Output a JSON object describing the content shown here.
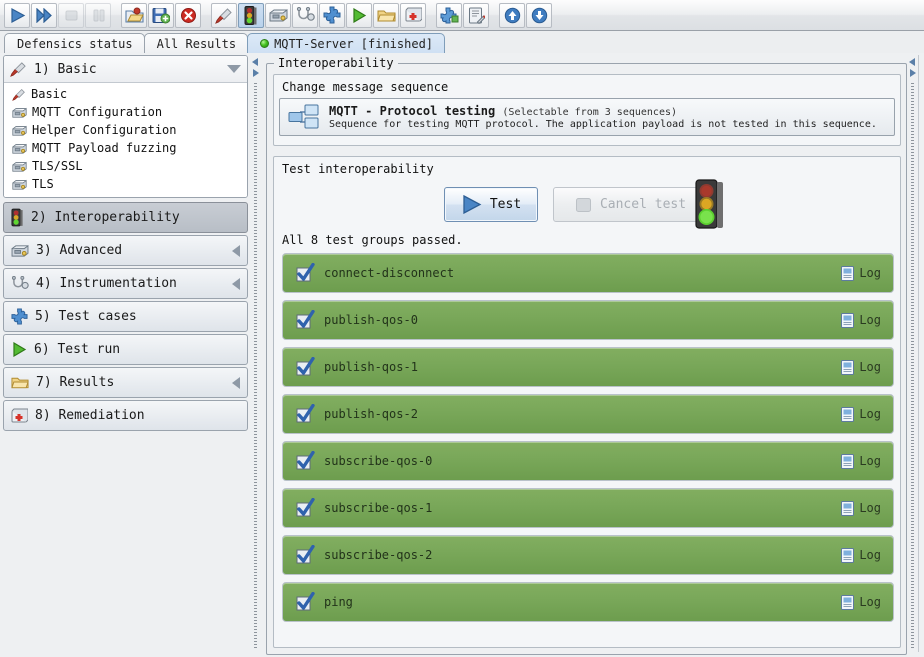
{
  "toolbar": {
    "buttons": [
      {
        "name": "run-icon",
        "label": "Run",
        "state": "enabled"
      },
      {
        "name": "step-icon",
        "label": "Step",
        "state": "enabled"
      },
      {
        "name": "stop-icon",
        "label": "Stop",
        "state": "disabled"
      },
      {
        "name": "pause-icon",
        "label": "Pause",
        "state": "disabled"
      },
      {
        "name": "open-folder-icon",
        "label": "Open",
        "state": "enabled"
      },
      {
        "name": "save-icon",
        "label": "Save",
        "state": "enabled"
      },
      {
        "name": "close-icon",
        "label": "Close",
        "state": "enabled"
      },
      {
        "name": "screwdriver-icon",
        "label": "Basic",
        "state": "enabled"
      },
      {
        "name": "traffic-light-icon",
        "label": "Interoperability",
        "state": "active"
      },
      {
        "name": "toolbox-icon",
        "label": "Advanced",
        "state": "enabled"
      },
      {
        "name": "stethoscope-icon",
        "label": "Instrumentation",
        "state": "enabled"
      },
      {
        "name": "puzzle-icon",
        "label": "Test cases",
        "state": "enabled"
      },
      {
        "name": "play-green-icon",
        "label": "Test run",
        "state": "enabled"
      },
      {
        "name": "folder-icon",
        "label": "Results",
        "state": "enabled"
      },
      {
        "name": "first-aid-icon",
        "label": "Remediation",
        "state": "enabled"
      },
      {
        "name": "plugin-icon",
        "label": "Plugins",
        "state": "enabled"
      },
      {
        "name": "notes-icon",
        "label": "Notes",
        "state": "enabled"
      },
      {
        "name": "arrow-up-icon",
        "label": "Previous",
        "state": "enabled"
      },
      {
        "name": "arrow-down-icon",
        "label": "Next",
        "state": "enabled"
      }
    ]
  },
  "tabs": [
    {
      "label": "Defensics status",
      "selected": false,
      "has_dot": false
    },
    {
      "label": "All Results",
      "selected": false,
      "has_dot": false
    },
    {
      "label": "MQTT-Server [finished]",
      "selected": true,
      "has_dot": true
    }
  ],
  "sidebar": {
    "open_section": {
      "number_label": "1) Basic",
      "icon": "screwdriver-icon",
      "items": [
        {
          "label": "Basic",
          "icon": "screwdriver-icon"
        },
        {
          "label": "MQTT Configuration",
          "icon": "toolbox-icon"
        },
        {
          "label": "Helper Configuration",
          "icon": "toolbox-icon"
        },
        {
          "label": "MQTT Payload fuzzing",
          "icon": "toolbox-icon"
        },
        {
          "label": "TLS/SSL",
          "icon": "toolbox-icon"
        },
        {
          "label": "TLS",
          "icon": "toolbox-icon"
        }
      ]
    },
    "sections": [
      {
        "label": "2) Interoperability",
        "icon": "traffic-light-icon",
        "selected": true,
        "collapsible": false
      },
      {
        "label": "3) Advanced",
        "icon": "toolbox-icon",
        "selected": false,
        "collapsible": true
      },
      {
        "label": "4) Instrumentation",
        "icon": "stethoscope-icon",
        "selected": false,
        "collapsible": true
      },
      {
        "label": "5) Test cases",
        "icon": "puzzle-icon",
        "selected": false,
        "collapsible": false
      },
      {
        "label": "6) Test run",
        "icon": "play-green-icon",
        "selected": false,
        "collapsible": false
      },
      {
        "label": "7) Results",
        "icon": "folder-icon",
        "selected": false,
        "collapsible": true
      },
      {
        "label": "8) Remediation",
        "icon": "first-aid-icon",
        "selected": false,
        "collapsible": false
      }
    ]
  },
  "main": {
    "group_title": "Interoperability",
    "sequence_group": {
      "label": "Change message sequence",
      "item": {
        "icon": "sequence-boxes-icon",
        "title": "MQTT - Protocol testing",
        "subtitle": "(Selectable from 3 sequences)",
        "description": "Sequence for testing MQTT protocol. The application payload is not tested in this sequence."
      }
    },
    "test_group": {
      "label": "Test interoperability",
      "test_button": "Test",
      "cancel_button": "Cancel test",
      "cancel_disabled": true,
      "traffic_light": "traffic-light-green-icon",
      "summary": "All 8 test groups passed.",
      "log_label": "Log",
      "rows": [
        {
          "name": "connect-disconnect",
          "status": "passed"
        },
        {
          "name": "publish-qos-0",
          "status": "passed"
        },
        {
          "name": "publish-qos-1",
          "status": "passed"
        },
        {
          "name": "publish-qos-2",
          "status": "passed"
        },
        {
          "name": "subscribe-qos-0",
          "status": "passed"
        },
        {
          "name": "subscribe-qos-1",
          "status": "passed"
        },
        {
          "name": "subscribe-qos-2",
          "status": "passed"
        },
        {
          "name": "ping",
          "status": "passed"
        }
      ]
    }
  },
  "colors": {
    "pass_green": "#7aa85a",
    "accent_blue": "#3a6ea5",
    "panel_bg": "#eef0f2",
    "status_dot_green": "#49c423"
  }
}
